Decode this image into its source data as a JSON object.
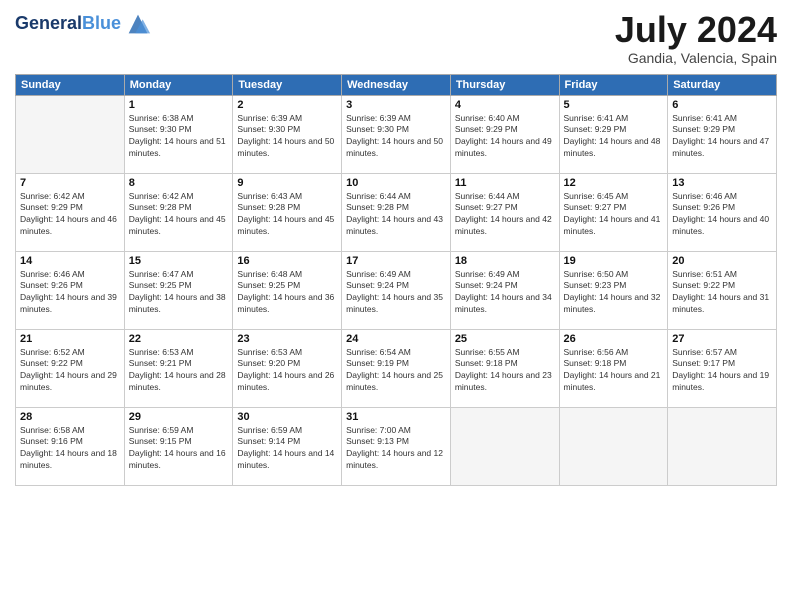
{
  "header": {
    "logo_line1": "General",
    "logo_line2": "Blue",
    "month_title": "July 2024",
    "location": "Gandia, Valencia, Spain"
  },
  "days_of_week": [
    "Sunday",
    "Monday",
    "Tuesday",
    "Wednesday",
    "Thursday",
    "Friday",
    "Saturday"
  ],
  "weeks": [
    [
      {
        "day": "",
        "empty": true
      },
      {
        "day": "1",
        "sunrise": "Sunrise: 6:38 AM",
        "sunset": "Sunset: 9:30 PM",
        "daylight": "Daylight: 14 hours and 51 minutes."
      },
      {
        "day": "2",
        "sunrise": "Sunrise: 6:39 AM",
        "sunset": "Sunset: 9:30 PM",
        "daylight": "Daylight: 14 hours and 50 minutes."
      },
      {
        "day": "3",
        "sunrise": "Sunrise: 6:39 AM",
        "sunset": "Sunset: 9:30 PM",
        "daylight": "Daylight: 14 hours and 50 minutes."
      },
      {
        "day": "4",
        "sunrise": "Sunrise: 6:40 AM",
        "sunset": "Sunset: 9:29 PM",
        "daylight": "Daylight: 14 hours and 49 minutes."
      },
      {
        "day": "5",
        "sunrise": "Sunrise: 6:41 AM",
        "sunset": "Sunset: 9:29 PM",
        "daylight": "Daylight: 14 hours and 48 minutes."
      },
      {
        "day": "6",
        "sunrise": "Sunrise: 6:41 AM",
        "sunset": "Sunset: 9:29 PM",
        "daylight": "Daylight: 14 hours and 47 minutes."
      }
    ],
    [
      {
        "day": "7",
        "sunrise": "Sunrise: 6:42 AM",
        "sunset": "Sunset: 9:29 PM",
        "daylight": "Daylight: 14 hours and 46 minutes."
      },
      {
        "day": "8",
        "sunrise": "Sunrise: 6:42 AM",
        "sunset": "Sunset: 9:28 PM",
        "daylight": "Daylight: 14 hours and 45 minutes."
      },
      {
        "day": "9",
        "sunrise": "Sunrise: 6:43 AM",
        "sunset": "Sunset: 9:28 PM",
        "daylight": "Daylight: 14 hours and 45 minutes."
      },
      {
        "day": "10",
        "sunrise": "Sunrise: 6:44 AM",
        "sunset": "Sunset: 9:28 PM",
        "daylight": "Daylight: 14 hours and 43 minutes."
      },
      {
        "day": "11",
        "sunrise": "Sunrise: 6:44 AM",
        "sunset": "Sunset: 9:27 PM",
        "daylight": "Daylight: 14 hours and 42 minutes."
      },
      {
        "day": "12",
        "sunrise": "Sunrise: 6:45 AM",
        "sunset": "Sunset: 9:27 PM",
        "daylight": "Daylight: 14 hours and 41 minutes."
      },
      {
        "day": "13",
        "sunrise": "Sunrise: 6:46 AM",
        "sunset": "Sunset: 9:26 PM",
        "daylight": "Daylight: 14 hours and 40 minutes."
      }
    ],
    [
      {
        "day": "14",
        "sunrise": "Sunrise: 6:46 AM",
        "sunset": "Sunset: 9:26 PM",
        "daylight": "Daylight: 14 hours and 39 minutes."
      },
      {
        "day": "15",
        "sunrise": "Sunrise: 6:47 AM",
        "sunset": "Sunset: 9:25 PM",
        "daylight": "Daylight: 14 hours and 38 minutes."
      },
      {
        "day": "16",
        "sunrise": "Sunrise: 6:48 AM",
        "sunset": "Sunset: 9:25 PM",
        "daylight": "Daylight: 14 hours and 36 minutes."
      },
      {
        "day": "17",
        "sunrise": "Sunrise: 6:49 AM",
        "sunset": "Sunset: 9:24 PM",
        "daylight": "Daylight: 14 hours and 35 minutes."
      },
      {
        "day": "18",
        "sunrise": "Sunrise: 6:49 AM",
        "sunset": "Sunset: 9:24 PM",
        "daylight": "Daylight: 14 hours and 34 minutes."
      },
      {
        "day": "19",
        "sunrise": "Sunrise: 6:50 AM",
        "sunset": "Sunset: 9:23 PM",
        "daylight": "Daylight: 14 hours and 32 minutes."
      },
      {
        "day": "20",
        "sunrise": "Sunrise: 6:51 AM",
        "sunset": "Sunset: 9:22 PM",
        "daylight": "Daylight: 14 hours and 31 minutes."
      }
    ],
    [
      {
        "day": "21",
        "sunrise": "Sunrise: 6:52 AM",
        "sunset": "Sunset: 9:22 PM",
        "daylight": "Daylight: 14 hours and 29 minutes."
      },
      {
        "day": "22",
        "sunrise": "Sunrise: 6:53 AM",
        "sunset": "Sunset: 9:21 PM",
        "daylight": "Daylight: 14 hours and 28 minutes."
      },
      {
        "day": "23",
        "sunrise": "Sunrise: 6:53 AM",
        "sunset": "Sunset: 9:20 PM",
        "daylight": "Daylight: 14 hours and 26 minutes."
      },
      {
        "day": "24",
        "sunrise": "Sunrise: 6:54 AM",
        "sunset": "Sunset: 9:19 PM",
        "daylight": "Daylight: 14 hours and 25 minutes."
      },
      {
        "day": "25",
        "sunrise": "Sunrise: 6:55 AM",
        "sunset": "Sunset: 9:18 PM",
        "daylight": "Daylight: 14 hours and 23 minutes."
      },
      {
        "day": "26",
        "sunrise": "Sunrise: 6:56 AM",
        "sunset": "Sunset: 9:18 PM",
        "daylight": "Daylight: 14 hours and 21 minutes."
      },
      {
        "day": "27",
        "sunrise": "Sunrise: 6:57 AM",
        "sunset": "Sunset: 9:17 PM",
        "daylight": "Daylight: 14 hours and 19 minutes."
      }
    ],
    [
      {
        "day": "28",
        "sunrise": "Sunrise: 6:58 AM",
        "sunset": "Sunset: 9:16 PM",
        "daylight": "Daylight: 14 hours and 18 minutes."
      },
      {
        "day": "29",
        "sunrise": "Sunrise: 6:59 AM",
        "sunset": "Sunset: 9:15 PM",
        "daylight": "Daylight: 14 hours and 16 minutes."
      },
      {
        "day": "30",
        "sunrise": "Sunrise: 6:59 AM",
        "sunset": "Sunset: 9:14 PM",
        "daylight": "Daylight: 14 hours and 14 minutes."
      },
      {
        "day": "31",
        "sunrise": "Sunrise: 7:00 AM",
        "sunset": "Sunset: 9:13 PM",
        "daylight": "Daylight: 14 hours and 12 minutes."
      },
      {
        "day": "",
        "empty": true
      },
      {
        "day": "",
        "empty": true
      },
      {
        "day": "",
        "empty": true
      }
    ]
  ]
}
